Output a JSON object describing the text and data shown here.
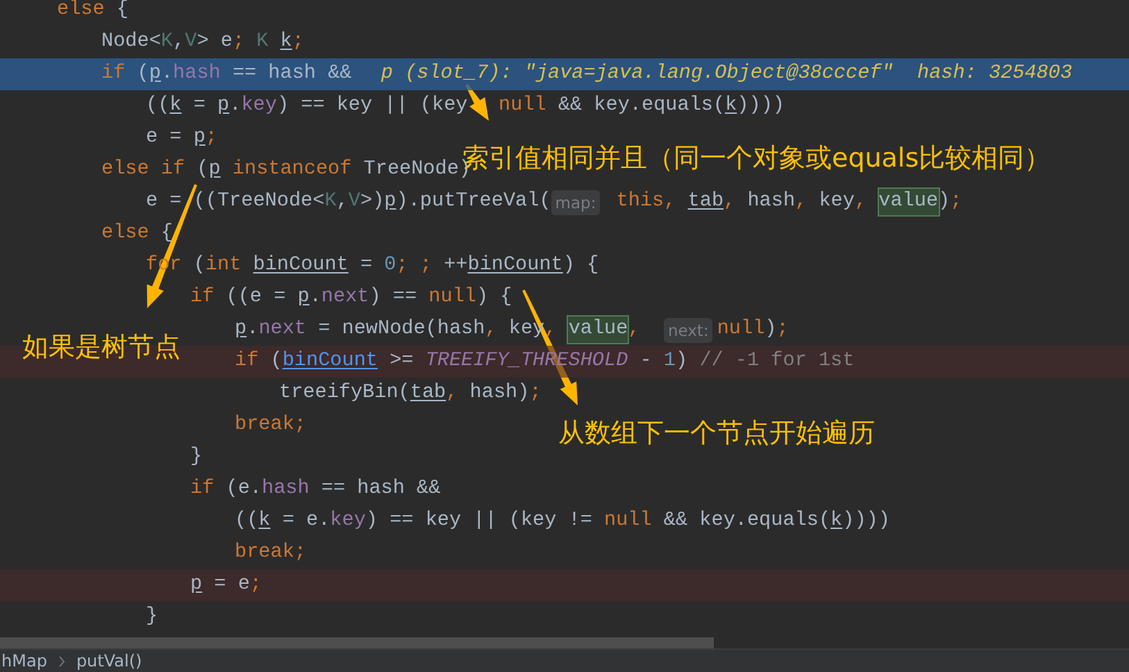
{
  "code_lines": [
    {
      "current": false,
      "breakpoint": false,
      "tokens": [
        {
          "text": "else",
          "kind": "kw"
        },
        {
          "text": " {",
          "kind": "p"
        }
      ],
      "children": [
        {
          "current": false,
          "breakpoint": false,
          "tokens": [
            {
              "text": "Node<",
              "kind": "p"
            },
            {
              "text": "K",
              "kind": "ty"
            },
            {
              "text": ",",
              "kind": "p"
            },
            {
              "text": "V",
              "kind": "ty"
            },
            {
              "text": "> e",
              "kind": "p"
            },
            {
              "text": "; ",
              "kind": "kw"
            },
            {
              "text": "K ",
              "kind": "ty"
            },
            {
              "text": "k",
              "kind": "loc"
            },
            {
              "text": ";",
              "kind": "kw"
            }
          ]
        },
        {
          "current": true,
          "breakpoint": false,
          "tokens": [
            {
              "text": "if",
              "kind": "kw"
            },
            {
              "text": " (",
              "kind": "p"
            },
            {
              "text": "p",
              "kind": "loc"
            },
            {
              "text": ".",
              "kind": "p"
            },
            {
              "text": "hash",
              "kind": "f"
            },
            {
              "text": " == hash &&  ",
              "kind": "p"
            },
            {
              "text": "p (slot_7): \"java=java.lang.Object@38cccef\"  hash: 3254803",
              "kind": "inl"
            }
          ],
          "children": [
            {
              "current": false,
              "breakpoint": false,
              "tokens": [
                {
                  "text": "((",
                  "kind": "p"
                },
                {
                  "text": "k",
                  "kind": "loc"
                },
                {
                  "text": " = ",
                  "kind": "p"
                },
                {
                  "text": "p",
                  "kind": "loc"
                },
                {
                  "text": ".",
                  "kind": "p"
                },
                {
                  "text": "key",
                  "kind": "f"
                },
                {
                  "text": ") == key || (key",
                  "kind": "p"
                },
                {
                  "kind": "gap"
                },
                {
                  "text": "null",
                  "kind": "kw"
                },
                {
                  "text": " && key.equals(",
                  "kind": "p"
                },
                {
                  "text": "k",
                  "kind": "loc"
                },
                {
                  "text": "))))",
                  "kind": "p"
                }
              ]
            },
            {
              "current": false,
              "breakpoint": false,
              "tokens": [
                {
                  "text": "e = ",
                  "kind": "p"
                },
                {
                  "text": "p",
                  "kind": "loc"
                },
                {
                  "text": ";",
                  "kind": "kw"
                }
              ]
            }
          ]
        },
        {
          "current": false,
          "breakpoint": false,
          "tokens": [
            {
              "text": "else if",
              "kind": "kw"
            },
            {
              "text": " (",
              "kind": "p"
            },
            {
              "text": "p",
              "kind": "loc"
            },
            {
              "text": " instanceof",
              "kind": "kw"
            },
            {
              "text": " TreeNode)",
              "kind": "p"
            }
          ],
          "children": [
            {
              "current": false,
              "breakpoint": false,
              "tokens": [
                {
                  "text": "e = ((TreeNode<",
                  "kind": "p"
                },
                {
                  "text": "K",
                  "kind": "ty"
                },
                {
                  "text": ",",
                  "kind": "p"
                },
                {
                  "text": "V",
                  "kind": "ty"
                },
                {
                  "text": ">)",
                  "kind": "p"
                },
                {
                  "text": "p",
                  "kind": "loc"
                },
                {
                  "text": ").putTreeVal(",
                  "kind": "p"
                },
                {
                  "text": "map:",
                  "kind": "hint"
                },
                {
                  "text": " this, ",
                  "kind": "kw"
                },
                {
                  "text": "tab",
                  "kind": "loc"
                },
                {
                  "text": ",",
                  "kind": "kw"
                },
                {
                  "text": " hash",
                  "kind": "p"
                },
                {
                  "text": ",",
                  "kind": "kw"
                },
                {
                  "text": " key",
                  "kind": "p"
                },
                {
                  "text": ", ",
                  "kind": "kw"
                },
                {
                  "text": "value",
                  "kind": "val"
                },
                {
                  "text": ")",
                  "kind": "p"
                },
                {
                  "text": ";",
                  "kind": "kw"
                }
              ]
            }
          ]
        },
        {
          "current": false,
          "breakpoint": false,
          "tokens": [
            {
              "text": "else",
              "kind": "kw"
            },
            {
              "text": " {",
              "kind": "p"
            }
          ],
          "children": [
            {
              "current": false,
              "breakpoint": false,
              "tokens": [
                {
                  "text": "for",
                  "kind": "kw"
                },
                {
                  "text": " (",
                  "kind": "p"
                },
                {
                  "text": "int ",
                  "kind": "kw"
                },
                {
                  "text": "binCount",
                  "kind": "loc"
                },
                {
                  "text": " = ",
                  "kind": "p"
                },
                {
                  "text": "0",
                  "kind": "num"
                },
                {
                  "text": "; ; ",
                  "kind": "kw"
                },
                {
                  "text": "++",
                  "kind": "p"
                },
                {
                  "text": "binCount",
                  "kind": "loc"
                },
                {
                  "text": ") {",
                  "kind": "p"
                }
              ],
              "children": [
                {
                  "current": false,
                  "breakpoint": false,
                  "tokens": [
                    {
                      "text": "if",
                      "kind": "kw"
                    },
                    {
                      "text": " ((e = ",
                      "kind": "p"
                    },
                    {
                      "text": "p",
                      "kind": "loc"
                    },
                    {
                      "text": ".",
                      "kind": "p"
                    },
                    {
                      "text": "next",
                      "kind": "f"
                    },
                    {
                      "text": ") == ",
                      "kind": "p"
                    },
                    {
                      "text": "null",
                      "kind": "kw"
                    },
                    {
                      "text": ") {",
                      "kind": "p"
                    }
                  ],
                  "children": [
                    {
                      "current": false,
                      "breakpoint": false,
                      "tokens": [
                        {
                          "text": "p",
                          "kind": "loc"
                        },
                        {
                          "text": ".",
                          "kind": "p"
                        },
                        {
                          "text": "next",
                          "kind": "f"
                        },
                        {
                          "text": " = newNode(hash",
                          "kind": "p"
                        },
                        {
                          "text": ",",
                          "kind": "kw"
                        },
                        {
                          "text": " key",
                          "kind": "p"
                        },
                        {
                          "text": ", ",
                          "kind": "kw"
                        },
                        {
                          "text": "value",
                          "kind": "val"
                        },
                        {
                          "text": ",  ",
                          "kind": "kw"
                        },
                        {
                          "text": "next:",
                          "kind": "hint"
                        },
                        {
                          "text": "null",
                          "kind": "kw"
                        },
                        {
                          "text": ")",
                          "kind": "p"
                        },
                        {
                          "text": ";",
                          "kind": "kw"
                        }
                      ]
                    },
                    {
                      "current": false,
                      "breakpoint": true,
                      "tokens": [
                        {
                          "text": "if",
                          "kind": "kw"
                        },
                        {
                          "text": " (",
                          "kind": "p"
                        },
                        {
                          "text": "binCount",
                          "kind": "ref"
                        },
                        {
                          "text": " >= ",
                          "kind": "p"
                        },
                        {
                          "text": "TREEIFY_THRESHOLD",
                          "kind": "st"
                        },
                        {
                          "text": " - ",
                          "kind": "p"
                        },
                        {
                          "text": "1",
                          "kind": "num"
                        },
                        {
                          "text": ") ",
                          "kind": "p"
                        },
                        {
                          "text": "// -1 for 1st",
                          "kind": "cm"
                        }
                      ],
                      "children": [
                        {
                          "current": false,
                          "breakpoint": false,
                          "tokens": [
                            {
                              "text": "treeifyBin(",
                              "kind": "p"
                            },
                            {
                              "text": "tab",
                              "kind": "loc"
                            },
                            {
                              "text": ",",
                              "kind": "kw"
                            },
                            {
                              "text": " hash)",
                              "kind": "p"
                            },
                            {
                              "text": ";",
                              "kind": "kw"
                            }
                          ]
                        }
                      ]
                    },
                    {
                      "current": false,
                      "breakpoint": false,
                      "tokens": [
                        {
                          "text": "break;",
                          "kind": "kw"
                        }
                      ]
                    }
                  ]
                },
                {
                  "current": false,
                  "breakpoint": false,
                  "tokens": [
                    {
                      "text": "}",
                      "kind": "p"
                    }
                  ]
                },
                {
                  "current": false,
                  "breakpoint": false,
                  "tokens": [
                    {
                      "text": "if",
                      "kind": "kw"
                    },
                    {
                      "text": " (e.",
                      "kind": "p"
                    },
                    {
                      "text": "hash",
                      "kind": "f"
                    },
                    {
                      "text": " == hash &&",
                      "kind": "p"
                    }
                  ],
                  "children": [
                    {
                      "current": false,
                      "breakpoint": false,
                      "tokens": [
                        {
                          "text": "((",
                          "kind": "p"
                        },
                        {
                          "text": "k",
                          "kind": "loc"
                        },
                        {
                          "text": " = e.",
                          "kind": "p"
                        },
                        {
                          "text": "key",
                          "kind": "f"
                        },
                        {
                          "text": ") == key || (key != ",
                          "kind": "p"
                        },
                        {
                          "text": "null",
                          "kind": "kw"
                        },
                        {
                          "text": " && key.equals(",
                          "kind": "p"
                        },
                        {
                          "text": "k",
                          "kind": "loc"
                        },
                        {
                          "text": "))))",
                          "kind": "p"
                        }
                      ]
                    },
                    {
                      "current": false,
                      "breakpoint": false,
                      "tokens": [
                        {
                          "text": "break;",
                          "kind": "kw"
                        }
                      ]
                    }
                  ]
                },
                {
                  "current": false,
                  "breakpoint": true,
                  "tokens": [
                    {
                      "text": "p",
                      "kind": "loc"
                    },
                    {
                      "text": " = e",
                      "kind": "p"
                    },
                    {
                      "text": ";",
                      "kind": "kw"
                    }
                  ]
                }
              ]
            },
            {
              "current": false,
              "breakpoint": false,
              "tokens": [
                {
                  "text": "}",
                  "kind": "p"
                }
              ]
            }
          ]
        }
      ]
    }
  ],
  "annotations": [
    {
      "text": "索引值相同并且（同一个对象或equals比较相同）"
    },
    {
      "text": "如果是树节点"
    },
    {
      "text": "从数组下一个节点开始遍历"
    }
  ],
  "breadcrumbs": [
    "hMap",
    "putVal()"
  ]
}
